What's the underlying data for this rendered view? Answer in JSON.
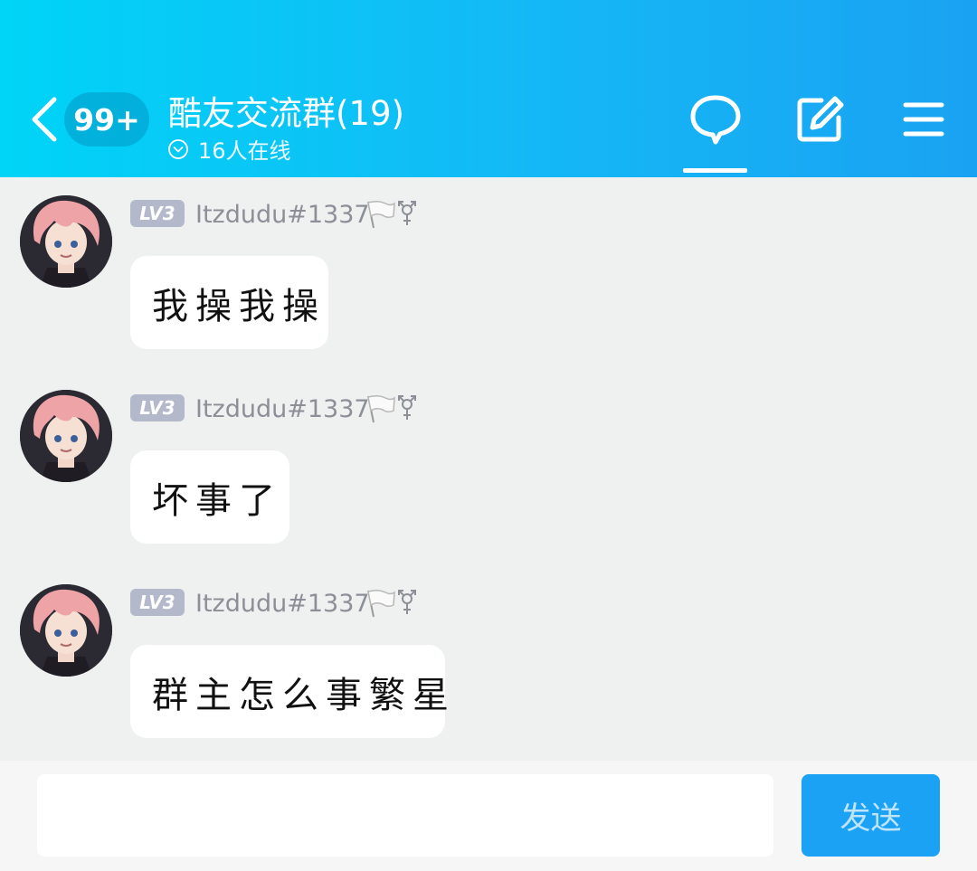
{
  "header": {
    "unread_badge": "99+",
    "title": "酷友交流群(19)",
    "online_status": "16人在线",
    "icons": [
      "back-icon",
      "chevron-down-circle-icon",
      "chat-bubble-icon",
      "edit-icon",
      "menu-icon"
    ],
    "active_tab": "chat"
  },
  "messages": [
    {
      "level": "LV3",
      "username": "Itzdudu#1337",
      "text": "我操我操"
    },
    {
      "level": "LV3",
      "username": "Itzdudu#1337",
      "text": "坏事了"
    },
    {
      "level": "LV3",
      "username": "Itzdudu#1337",
      "text": "群主怎么事繁星"
    }
  ],
  "composer": {
    "input_value": "",
    "send_label": "发送"
  },
  "colors": {
    "header_gradient_start": "#00d4f7",
    "header_gradient_end": "#1aa2f2",
    "background": "#eef1ef",
    "send_button": "#1ca2f5",
    "level_badge": "#b3b9cb"
  }
}
